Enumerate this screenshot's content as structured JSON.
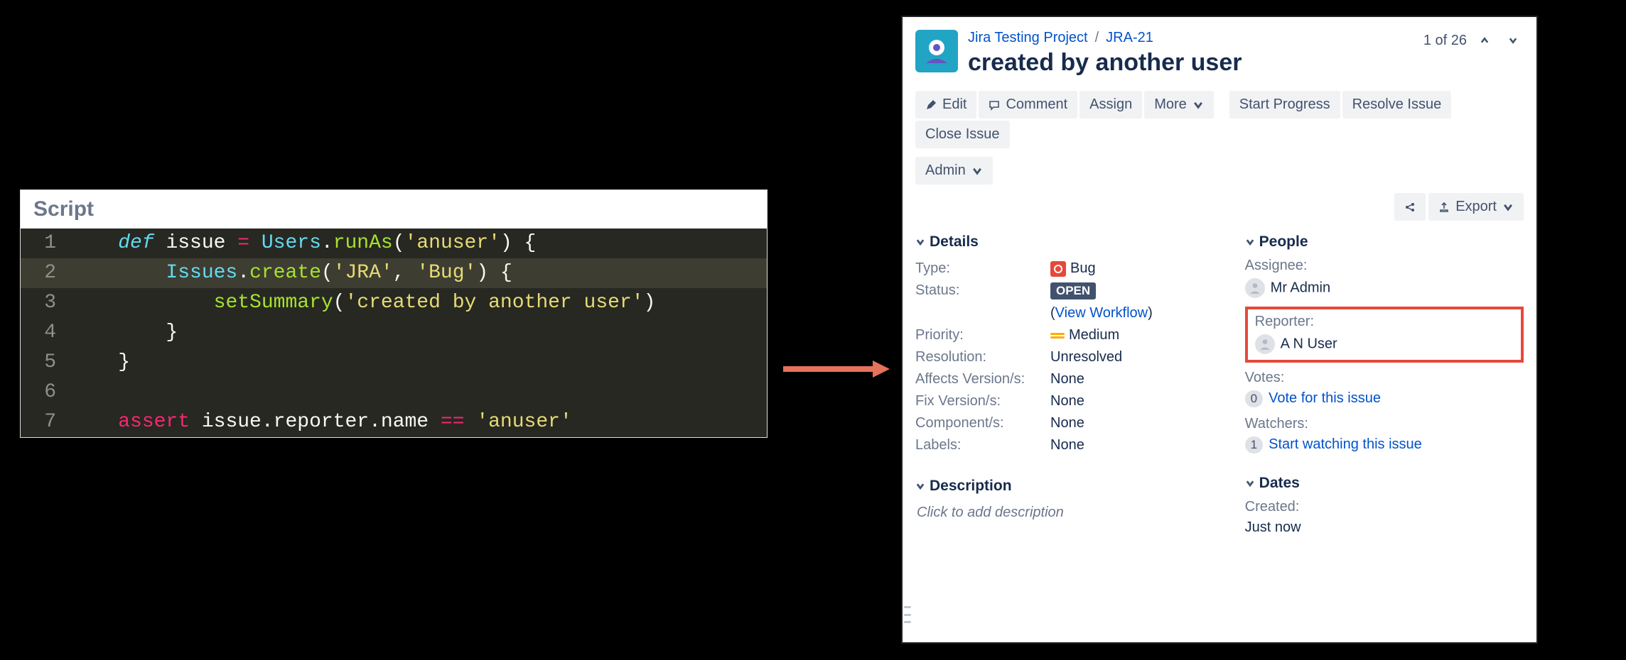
{
  "code_editor": {
    "title": "Script",
    "lines": [
      {
        "n": 1,
        "segments": [
          {
            "t": "def ",
            "c": "tok-def"
          },
          {
            "t": "issue ",
            "c": "tok-var"
          },
          {
            "t": "= ",
            "c": "tok-op"
          },
          {
            "t": "Users",
            "c": "tok-type"
          },
          {
            "t": ".",
            "c": "tok-pun"
          },
          {
            "t": "runAs",
            "c": "tok-fn"
          },
          {
            "t": "(",
            "c": "tok-pun"
          },
          {
            "t": "'anuser'",
            "c": "tok-str"
          },
          {
            "t": ") {",
            "c": "tok-pun"
          }
        ]
      },
      {
        "n": 2,
        "hl": true,
        "indent": 1,
        "segments": [
          {
            "t": "Issues",
            "c": "tok-type"
          },
          {
            "t": ".",
            "c": "tok-pun"
          },
          {
            "t": "create",
            "c": "tok-fn"
          },
          {
            "t": "(",
            "c": "tok-pun"
          },
          {
            "t": "'JRA'",
            "c": "tok-str"
          },
          {
            "t": ", ",
            "c": "tok-pun"
          },
          {
            "t": "'Bug'",
            "c": "tok-str"
          },
          {
            "t": ") {",
            "c": "tok-pun"
          }
        ]
      },
      {
        "n": 3,
        "indent": 2,
        "segments": [
          {
            "t": "setSummary",
            "c": "tok-fn"
          },
          {
            "t": "(",
            "c": "tok-pun"
          },
          {
            "t": "'created by another user'",
            "c": "tok-str"
          },
          {
            "t": ")",
            "c": "tok-pun"
          }
        ]
      },
      {
        "n": 4,
        "indent": 1,
        "segments": [
          {
            "t": "}",
            "c": "tok-pun"
          }
        ]
      },
      {
        "n": 5,
        "segments": [
          {
            "t": "}",
            "c": "tok-pun"
          }
        ]
      },
      {
        "n": 6,
        "segments": []
      },
      {
        "n": 7,
        "segments": [
          {
            "t": "assert ",
            "c": "tok-kw"
          },
          {
            "t": "issue.reporter.name ",
            "c": "tok-var"
          },
          {
            "t": "== ",
            "c": "tok-op"
          },
          {
            "t": "'anuser'",
            "c": "tok-str"
          }
        ]
      }
    ]
  },
  "jira": {
    "breadcrumb": {
      "project": "Jira Testing Project",
      "key": "JRA-21"
    },
    "summary": "created by another user",
    "pager": {
      "text": "1 of 26"
    },
    "toolbar": {
      "edit": "Edit",
      "comment": "Comment",
      "assign": "Assign",
      "more": "More",
      "start_progress": "Start Progress",
      "resolve": "Resolve Issue",
      "close": "Close Issue",
      "admin": "Admin",
      "export": "Export"
    },
    "details": {
      "title": "Details",
      "type_label": "Type:",
      "type_value": "Bug",
      "status_label": "Status:",
      "status_value": "OPEN",
      "view_workflow": "View Workflow",
      "priority_label": "Priority:",
      "priority_value": "Medium",
      "resolution_label": "Resolution:",
      "resolution_value": "Unresolved",
      "affects_label": "Affects Version/s:",
      "affects_value": "None",
      "fix_label": "Fix Version/s:",
      "fix_value": "None",
      "components_label": "Component/s:",
      "components_value": "None",
      "labels_label": "Labels:",
      "labels_value": "None"
    },
    "people": {
      "title": "People",
      "assignee_label": "Assignee:",
      "assignee_value": "Mr Admin",
      "reporter_label": "Reporter:",
      "reporter_value": "A N User",
      "votes_label": "Votes:",
      "votes_count": "0",
      "votes_link": "Vote for this issue",
      "watchers_label": "Watchers:",
      "watchers_count": "1",
      "watchers_link": "Start watching this issue"
    },
    "description": {
      "title": "Description",
      "placeholder": "Click to add description"
    },
    "dates": {
      "title": "Dates",
      "created_label": "Created:",
      "created_value": "Just now"
    }
  }
}
